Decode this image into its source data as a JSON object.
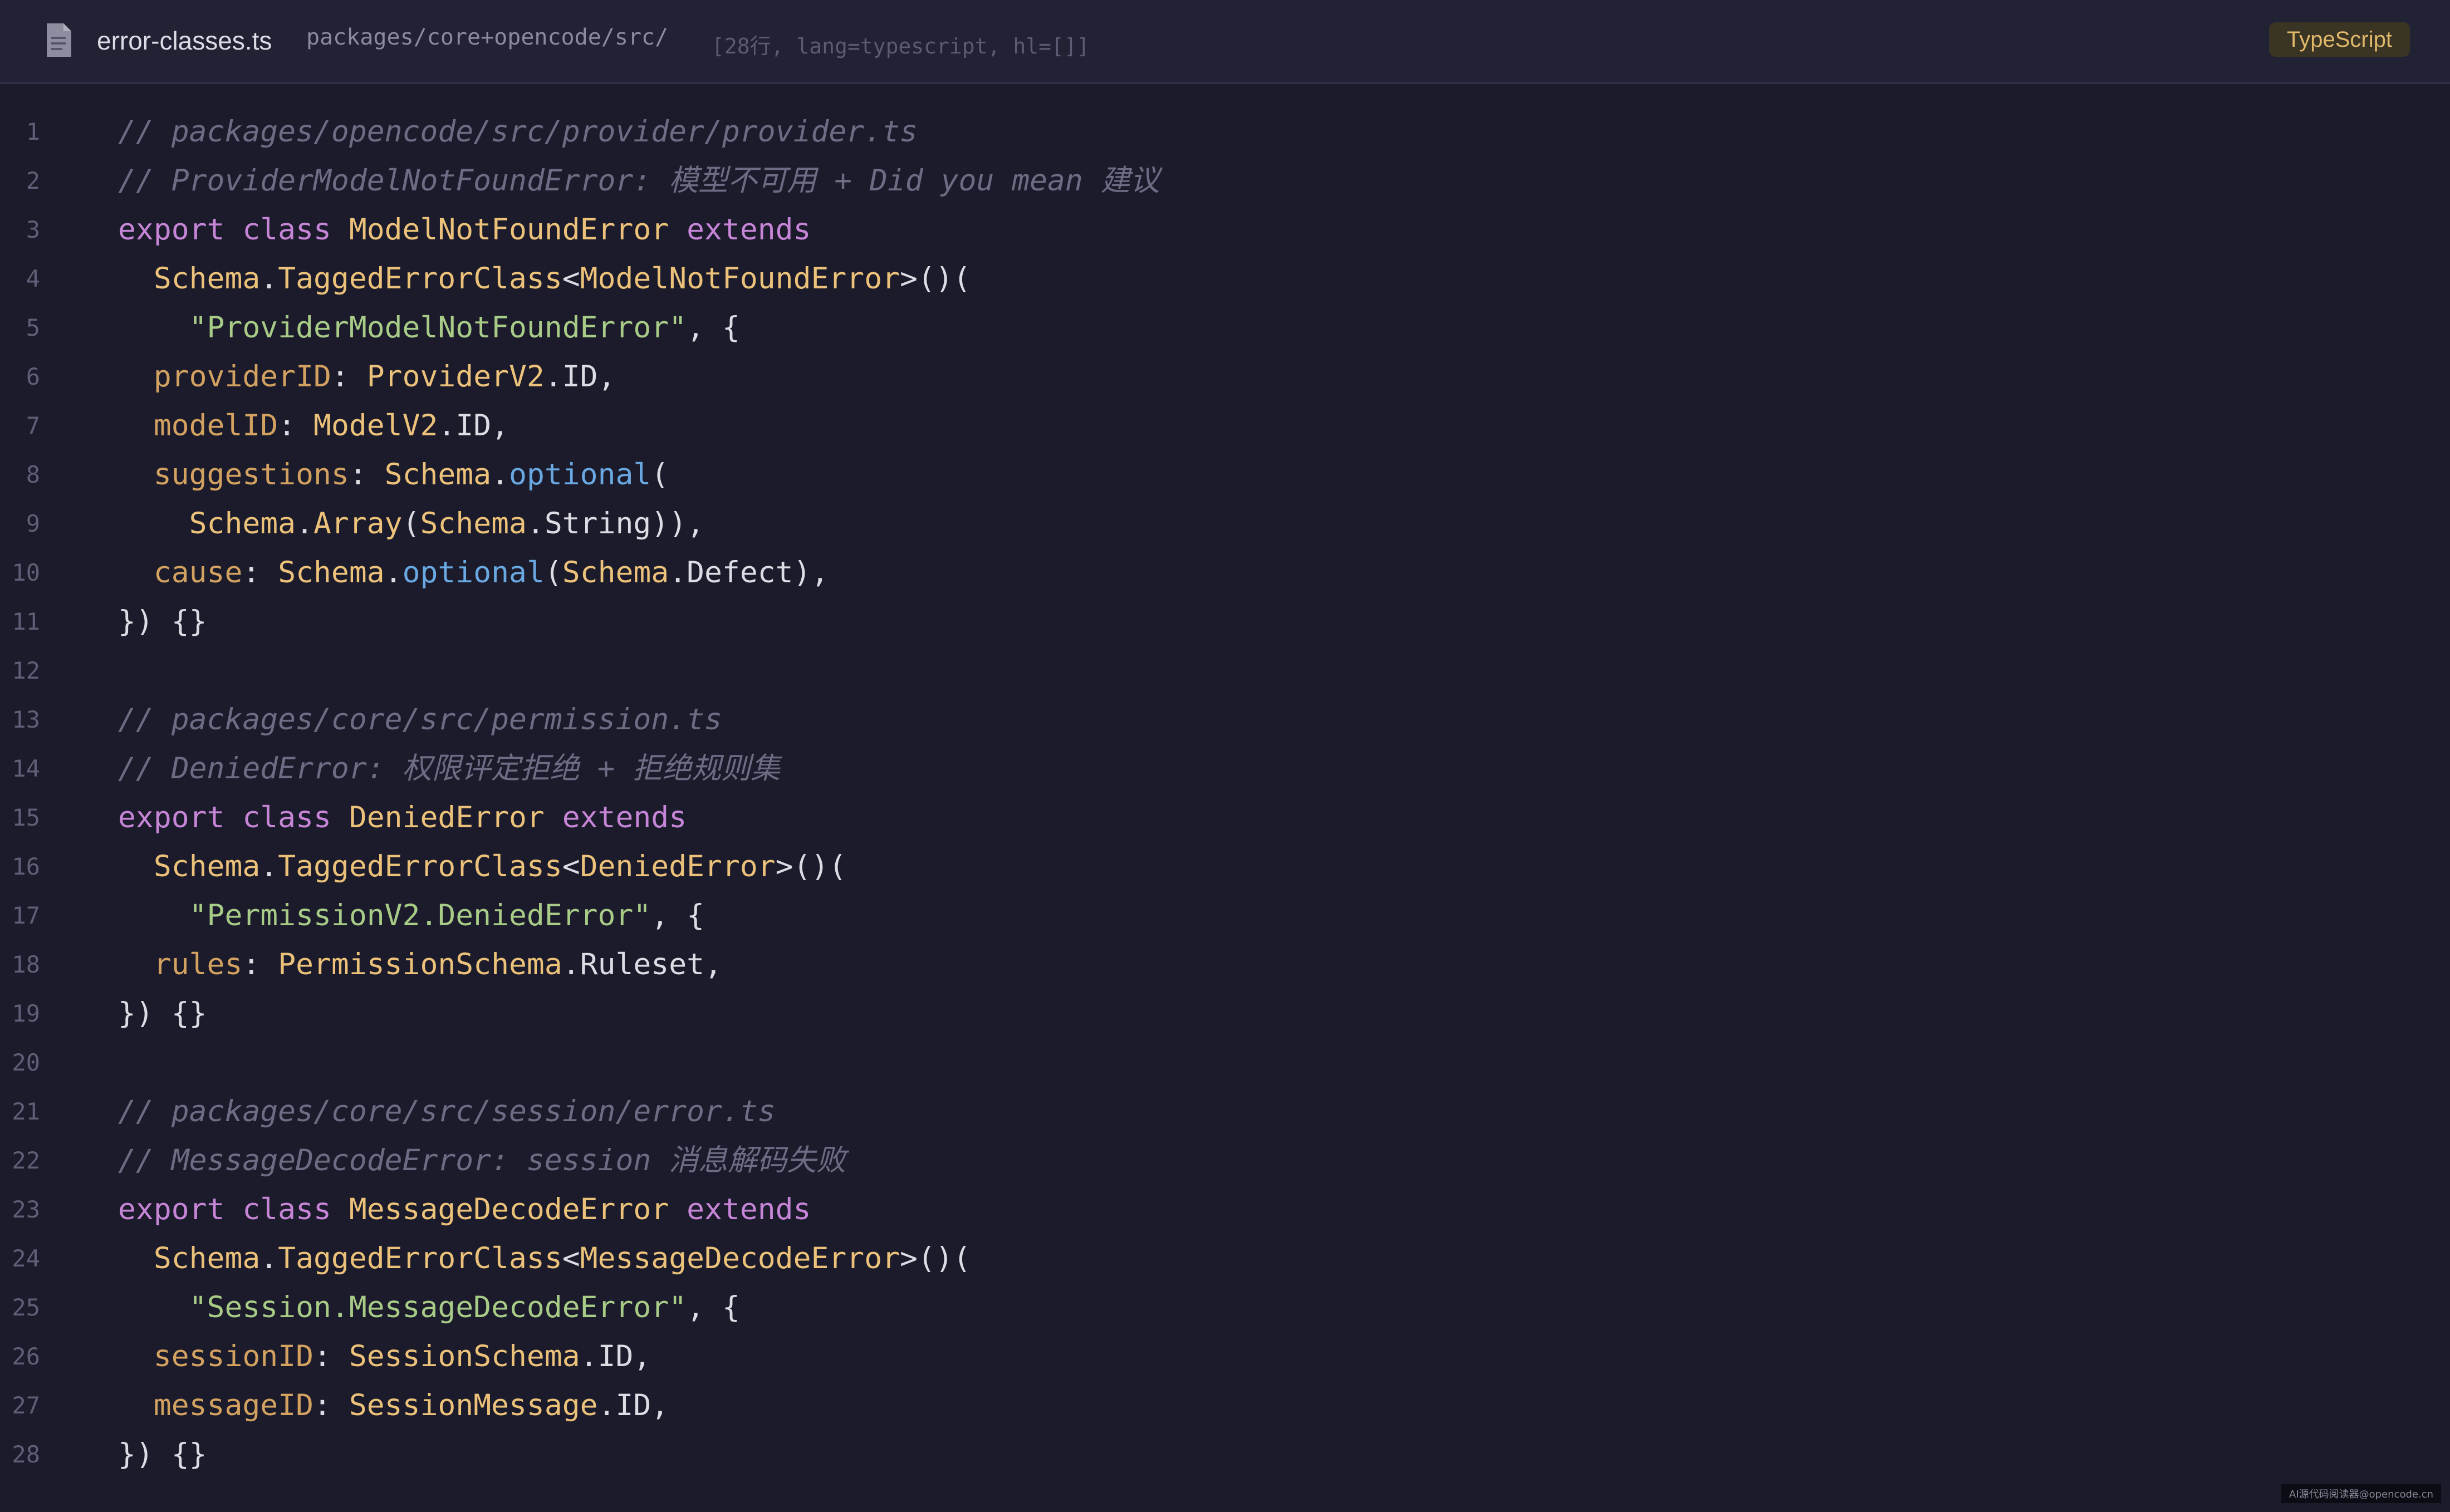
{
  "header": {
    "file_icon": "document-icon",
    "file_name": "error-classes.ts",
    "file_path": "packages/core+opencode/src/",
    "file_meta": "[28行, lang=typescript, hl=[]]",
    "language_badge": "TypeScript"
  },
  "colors": {
    "background": "#1b1b2b",
    "header_background": "#222235",
    "comment": "#6c6c84",
    "keyword": "#c685d6",
    "type": "#ecc27a",
    "property": "#d3a261",
    "string": "#a8cc87",
    "function": "#6aa8e2",
    "plain": "#dcdce4",
    "line_number": "#5f5f78",
    "badge_text": "#e0b86a"
  },
  "code": {
    "lines": [
      {
        "n": "1",
        "tokens": [
          {
            "t": "// packages/opencode/src/provider/provider.ts",
            "k": "comment"
          }
        ]
      },
      {
        "n": "2",
        "tokens": [
          {
            "t": "// ProviderModelNotFoundError: 模型不可用 + Did you mean 建议",
            "k": "comment"
          }
        ]
      },
      {
        "n": "3",
        "tokens": [
          {
            "t": "export class ",
            "k": "kw"
          },
          {
            "t": "ModelNotFoundError",
            "k": "type"
          },
          {
            "t": " extends",
            "k": "kw"
          }
        ]
      },
      {
        "n": "4",
        "tokens": [
          {
            "t": "  ",
            "k": "plain"
          },
          {
            "t": "Schema",
            "k": "type"
          },
          {
            "t": ".",
            "k": "plain"
          },
          {
            "t": "TaggedErrorClass",
            "k": "type"
          },
          {
            "t": "<",
            "k": "plain"
          },
          {
            "t": "ModelNotFoundError",
            "k": "type"
          },
          {
            "t": ">()(",
            "k": "plain"
          }
        ]
      },
      {
        "n": "5",
        "tokens": [
          {
            "t": "    ",
            "k": "plain"
          },
          {
            "t": "\"ProviderModelNotFoundError\"",
            "k": "str"
          },
          {
            "t": ", {",
            "k": "plain"
          }
        ]
      },
      {
        "n": "6",
        "tokens": [
          {
            "t": "  ",
            "k": "plain"
          },
          {
            "t": "providerID",
            "k": "prop"
          },
          {
            "t": ": ",
            "k": "plain"
          },
          {
            "t": "ProviderV2",
            "k": "type"
          },
          {
            "t": ".ID,",
            "k": "plain"
          }
        ]
      },
      {
        "n": "7",
        "tokens": [
          {
            "t": "  ",
            "k": "plain"
          },
          {
            "t": "modelID",
            "k": "prop"
          },
          {
            "t": ": ",
            "k": "plain"
          },
          {
            "t": "ModelV2",
            "k": "type"
          },
          {
            "t": ".ID,",
            "k": "plain"
          }
        ]
      },
      {
        "n": "8",
        "tokens": [
          {
            "t": "  ",
            "k": "plain"
          },
          {
            "t": "suggestions",
            "k": "prop"
          },
          {
            "t": ": ",
            "k": "plain"
          },
          {
            "t": "Schema",
            "k": "type"
          },
          {
            "t": ".",
            "k": "plain"
          },
          {
            "t": "optional",
            "k": "fn"
          },
          {
            "t": "(",
            "k": "plain"
          }
        ]
      },
      {
        "n": "9",
        "tokens": [
          {
            "t": "    ",
            "k": "plain"
          },
          {
            "t": "Schema",
            "k": "type"
          },
          {
            "t": ".",
            "k": "plain"
          },
          {
            "t": "Array",
            "k": "type"
          },
          {
            "t": "(",
            "k": "plain"
          },
          {
            "t": "Schema",
            "k": "type"
          },
          {
            "t": ".String)),",
            "k": "plain"
          }
        ]
      },
      {
        "n": "10",
        "tokens": [
          {
            "t": "  ",
            "k": "plain"
          },
          {
            "t": "cause",
            "k": "prop"
          },
          {
            "t": ": ",
            "k": "plain"
          },
          {
            "t": "Schema",
            "k": "type"
          },
          {
            "t": ".",
            "k": "plain"
          },
          {
            "t": "optional",
            "k": "fn"
          },
          {
            "t": "(",
            "k": "plain"
          },
          {
            "t": "Schema",
            "k": "type"
          },
          {
            "t": ".Defect),",
            "k": "plain"
          }
        ]
      },
      {
        "n": "11",
        "tokens": [
          {
            "t": "}) {}",
            "k": "plain"
          }
        ]
      },
      {
        "n": "12",
        "tokens": []
      },
      {
        "n": "13",
        "tokens": [
          {
            "t": "// packages/core/src/permission.ts",
            "k": "comment"
          }
        ]
      },
      {
        "n": "14",
        "tokens": [
          {
            "t": "// DeniedError: 权限评定拒绝 + 拒绝规则集",
            "k": "comment"
          }
        ]
      },
      {
        "n": "15",
        "tokens": [
          {
            "t": "export class ",
            "k": "kw"
          },
          {
            "t": "DeniedError",
            "k": "type"
          },
          {
            "t": " extends",
            "k": "kw"
          }
        ]
      },
      {
        "n": "16",
        "tokens": [
          {
            "t": "  ",
            "k": "plain"
          },
          {
            "t": "Schema",
            "k": "type"
          },
          {
            "t": ".",
            "k": "plain"
          },
          {
            "t": "TaggedErrorClass",
            "k": "type"
          },
          {
            "t": "<",
            "k": "plain"
          },
          {
            "t": "DeniedError",
            "k": "type"
          },
          {
            "t": ">()(",
            "k": "plain"
          }
        ]
      },
      {
        "n": "17",
        "tokens": [
          {
            "t": "    ",
            "k": "plain"
          },
          {
            "t": "\"PermissionV2.DeniedError\"",
            "k": "str"
          },
          {
            "t": ", {",
            "k": "plain"
          }
        ]
      },
      {
        "n": "18",
        "tokens": [
          {
            "t": "  ",
            "k": "plain"
          },
          {
            "t": "rules",
            "k": "prop"
          },
          {
            "t": ": ",
            "k": "plain"
          },
          {
            "t": "PermissionSchema",
            "k": "type"
          },
          {
            "t": ".Ruleset,",
            "k": "plain"
          }
        ]
      },
      {
        "n": "19",
        "tokens": [
          {
            "t": "}) {}",
            "k": "plain"
          }
        ]
      },
      {
        "n": "20",
        "tokens": []
      },
      {
        "n": "21",
        "tokens": [
          {
            "t": "// packages/core/src/session/error.ts",
            "k": "comment"
          }
        ]
      },
      {
        "n": "22",
        "tokens": [
          {
            "t": "// MessageDecodeError: session 消息解码失败",
            "k": "comment"
          }
        ]
      },
      {
        "n": "23",
        "tokens": [
          {
            "t": "export class ",
            "k": "kw"
          },
          {
            "t": "MessageDecodeError",
            "k": "type"
          },
          {
            "t": " extends",
            "k": "kw"
          }
        ]
      },
      {
        "n": "24",
        "tokens": [
          {
            "t": "  ",
            "k": "plain"
          },
          {
            "t": "Schema",
            "k": "type"
          },
          {
            "t": ".",
            "k": "plain"
          },
          {
            "t": "TaggedErrorClass",
            "k": "type"
          },
          {
            "t": "<",
            "k": "plain"
          },
          {
            "t": "MessageDecodeError",
            "k": "type"
          },
          {
            "t": ">()(",
            "k": "plain"
          }
        ]
      },
      {
        "n": "25",
        "tokens": [
          {
            "t": "    ",
            "k": "plain"
          },
          {
            "t": "\"Session.MessageDecodeError\"",
            "k": "str"
          },
          {
            "t": ", {",
            "k": "plain"
          }
        ]
      },
      {
        "n": "26",
        "tokens": [
          {
            "t": "  ",
            "k": "plain"
          },
          {
            "t": "sessionID",
            "k": "prop"
          },
          {
            "t": ": ",
            "k": "plain"
          },
          {
            "t": "SessionSchema",
            "k": "type"
          },
          {
            "t": ".ID,",
            "k": "plain"
          }
        ]
      },
      {
        "n": "27",
        "tokens": [
          {
            "t": "  ",
            "k": "plain"
          },
          {
            "t": "messageID",
            "k": "prop"
          },
          {
            "t": ": ",
            "k": "plain"
          },
          {
            "t": "SessionMessage",
            "k": "type"
          },
          {
            "t": ".ID,",
            "k": "plain"
          }
        ]
      },
      {
        "n": "28",
        "tokens": [
          {
            "t": "}) {}",
            "k": "plain"
          }
        ]
      }
    ]
  },
  "watermark": "AI源代码阅读器@opencode.cn"
}
